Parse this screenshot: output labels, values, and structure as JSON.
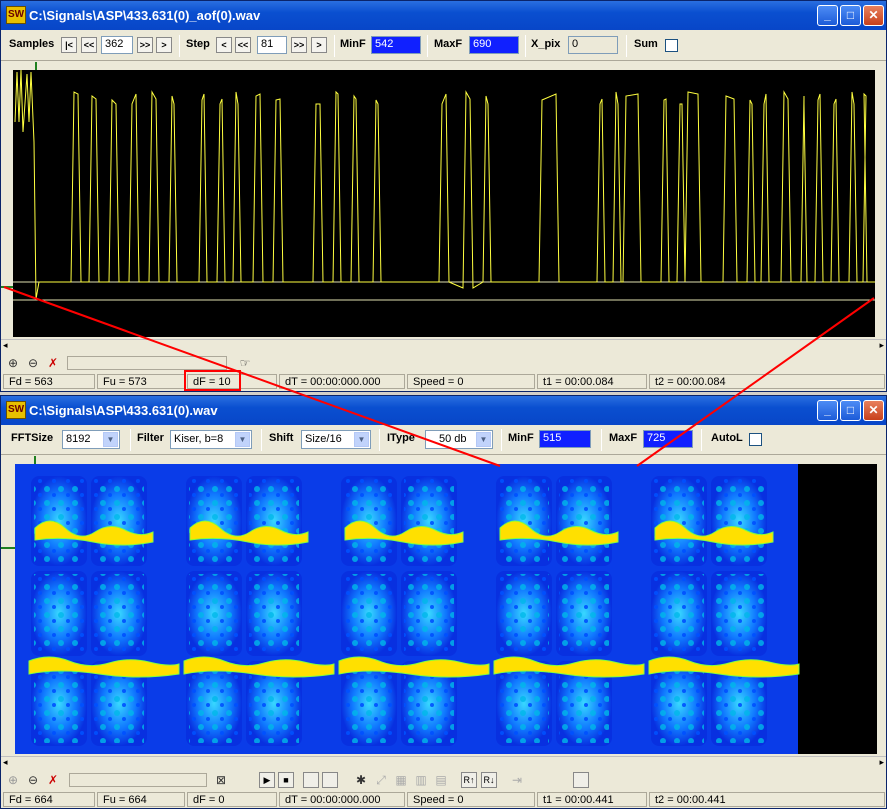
{
  "colors": {
    "accent": "#0a4fd0",
    "plot_bg": "#000000",
    "trace": "#ffff40",
    "minmax_field": "#1020ff",
    "annotation_red": "#ff0000"
  },
  "win1": {
    "title": "C:\\Signals\\ASP\\433.631(0)_aof(0).wav",
    "toolbar": {
      "samples_label": "Samples",
      "samples_value": "362",
      "step_label": "Step",
      "step_value": "81",
      "minf_label": "MinF",
      "minf_value": "542",
      "maxf_label": "MaxF",
      "maxf_value": "690",
      "xpix_label": "X_pix",
      "xpix_value": "0",
      "sum_label": "Sum"
    },
    "status": {
      "fd": "Fd = 563",
      "fu": "Fu = 573",
      "df": "dF = 10",
      "dt": "dT = 00:00:000.000",
      "speed": "Speed = 0",
      "t1": "t1 = 00:00.084",
      "t2": "t2 = 00:00.084"
    }
  },
  "win2": {
    "title": "C:\\Signals\\ASP\\433.631(0).wav",
    "toolbar": {
      "fftsize_label": "FFTSize",
      "fftsize_value": "8192",
      "filter_label": "Filter",
      "filter_value": "Kiser, b=8",
      "shift_label": "Shift",
      "shift_value": "Size/16",
      "itype_label": "IType",
      "itype_value": "50 db",
      "minf_label": "MinF",
      "minf_value": "515",
      "maxf_label": "MaxF",
      "maxf_value": "725",
      "autol_label": "AutoL"
    },
    "status": {
      "fd": "Fd = 664",
      "fu": "Fu = 664",
      "df": "dF = 0",
      "dt": "dT = 00:00:000.000",
      "speed": "Speed = 0",
      "t1": "t1 = 00:00.441",
      "t2": "t2 = 00:00.441"
    }
  },
  "icons": {
    "min": "minimize-icon",
    "max": "maximize-icon",
    "close": "close-icon",
    "zoom_in": "zoom-in-icon",
    "zoom_out": "zoom-out-icon",
    "reset": "reset-zoom-icon",
    "hand": "hand-icon"
  }
}
